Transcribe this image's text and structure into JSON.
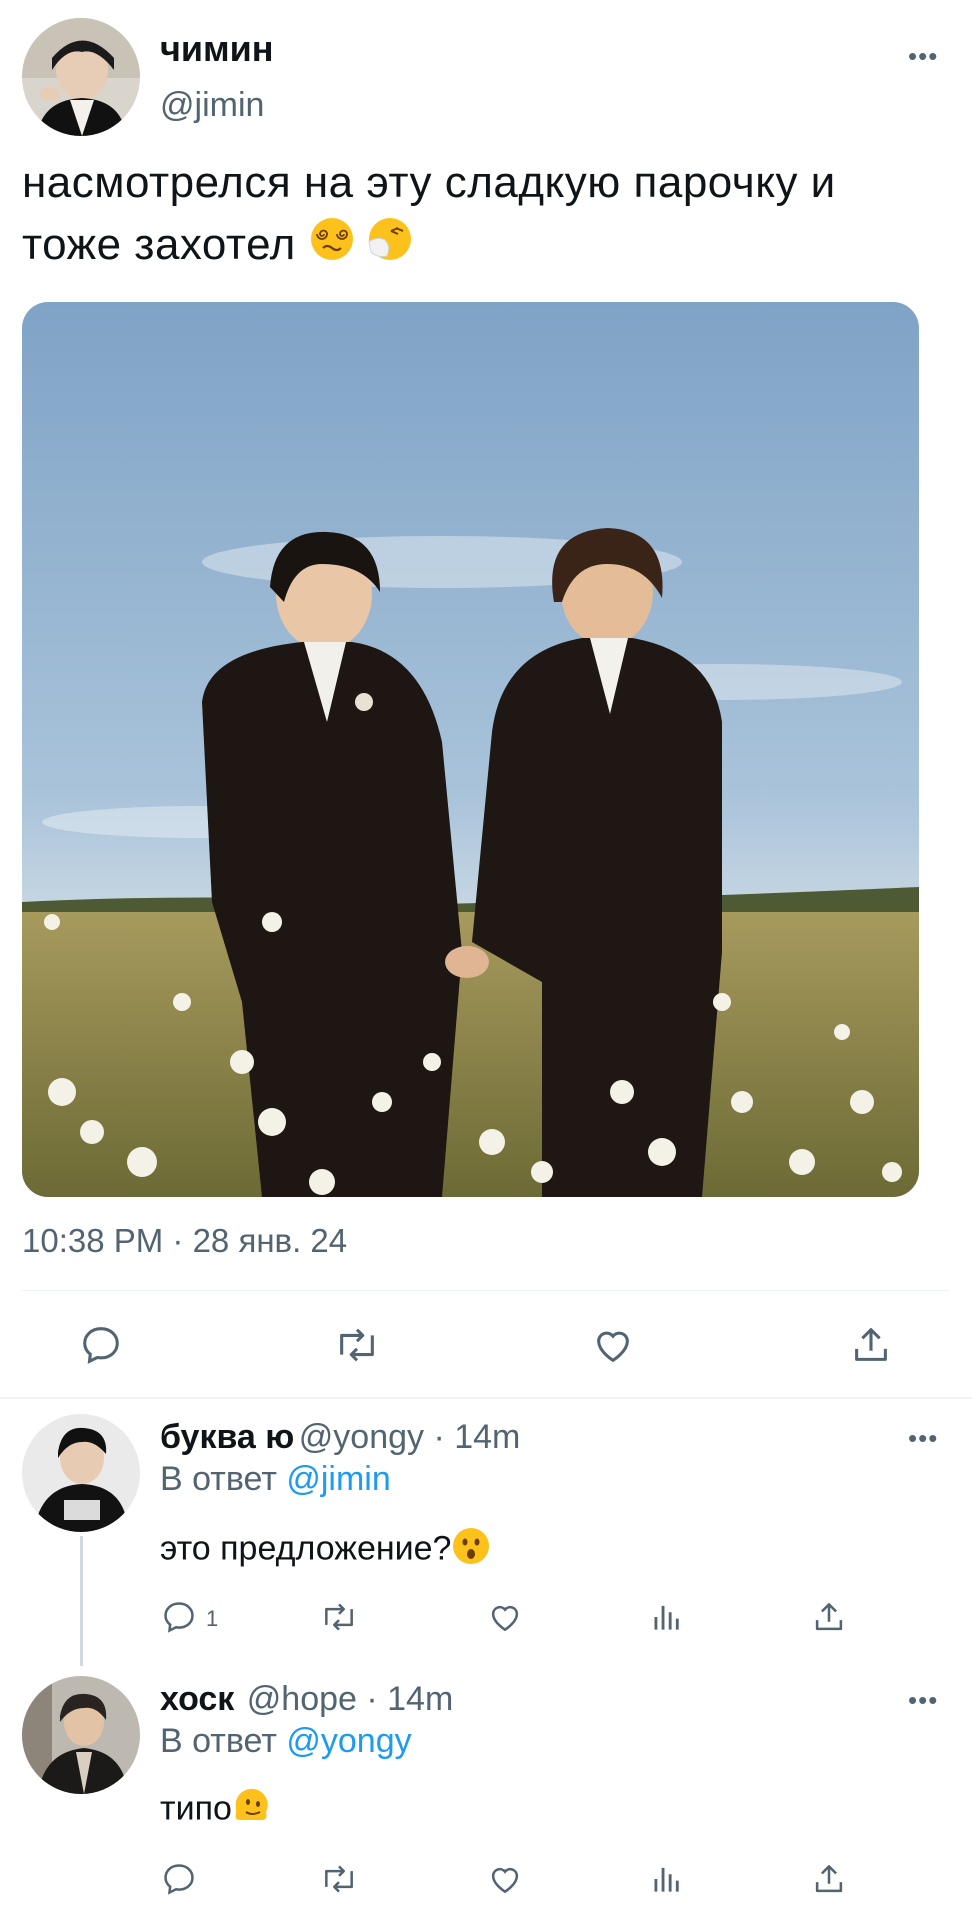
{
  "tweet": {
    "author_name": "чимин",
    "author_handle": "@jimin",
    "text_line1": "насмотрелся на эту сладкую парочку и",
    "text_line2": "тоже захотел",
    "timestamp": "10:38 PM · 28 янв. 24",
    "more_label": "•••",
    "image_icon": "photo-two-men-in-suits-in-flower-field",
    "actions": [
      "reply-icon",
      "retweet-icon",
      "like-icon",
      "share-icon"
    ]
  },
  "replies": [
    {
      "name": "буква ю",
      "handle": "@yongy · 14m",
      "reply_to_prefix": "В ответ",
      "reply_to_mention": "@jimin",
      "text": "это предложение?",
      "reply_count": "1",
      "more_label": "•••"
    },
    {
      "name": "хоск",
      "handle": "@hope · 14m",
      "reply_to_prefix": "В ответ",
      "reply_to_mention": "@yongy",
      "text": "типо",
      "more_label": "•••"
    }
  ],
  "colors": {
    "text": "#0f1419",
    "secondary": "#536471",
    "accent": "#1d9bf0",
    "divider": "#eff3f4"
  }
}
